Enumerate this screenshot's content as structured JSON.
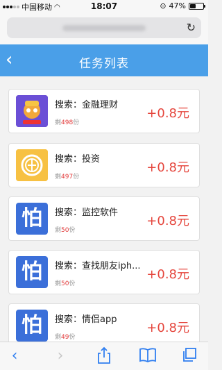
{
  "status_bar": {
    "carrier": "中国移动",
    "time": "18:07",
    "battery": "47%",
    "battery_level": 0.47
  },
  "header": {
    "title": "任务列表"
  },
  "tasks": [
    {
      "title": "搜索：金融理财",
      "remain_prefix": "剩",
      "remain_num": "498",
      "remain_unit": "份",
      "reward": "+0.8元",
      "icon": "gold-miner-app-icon",
      "icon_text": ""
    },
    {
      "title": "搜索：投资",
      "remain_prefix": "剩",
      "remain_num": "497",
      "remain_unit": "份",
      "reward": "+0.8元",
      "icon": "coin-app-icon",
      "icon_text": ""
    },
    {
      "title": "搜索：监控软件",
      "remain_prefix": "剩",
      "remain_num": "50",
      "remain_unit": "份",
      "reward": "+0.8元",
      "icon": "pa-app-icon",
      "icon_text": "怕"
    },
    {
      "title": "搜索：查找朋友iph...",
      "remain_prefix": "剩",
      "remain_num": "50",
      "remain_unit": "份",
      "reward": "+0.8元",
      "icon": "pa-app-icon",
      "icon_text": "怕"
    },
    {
      "title": "搜索：情侣app",
      "remain_prefix": "剩",
      "remain_num": "49",
      "remain_unit": "份",
      "reward": "+0.8元",
      "icon": "pa-app-icon",
      "icon_text": "怕"
    }
  ],
  "toolbar": {
    "items": [
      "back-icon",
      "forward-icon",
      "share-icon",
      "bookmarks-icon",
      "tabs-icon"
    ]
  },
  "colors": {
    "header": "#4a9fe8",
    "reward": "#e5463d",
    "toolbar_icon": "#2f7ef0"
  }
}
